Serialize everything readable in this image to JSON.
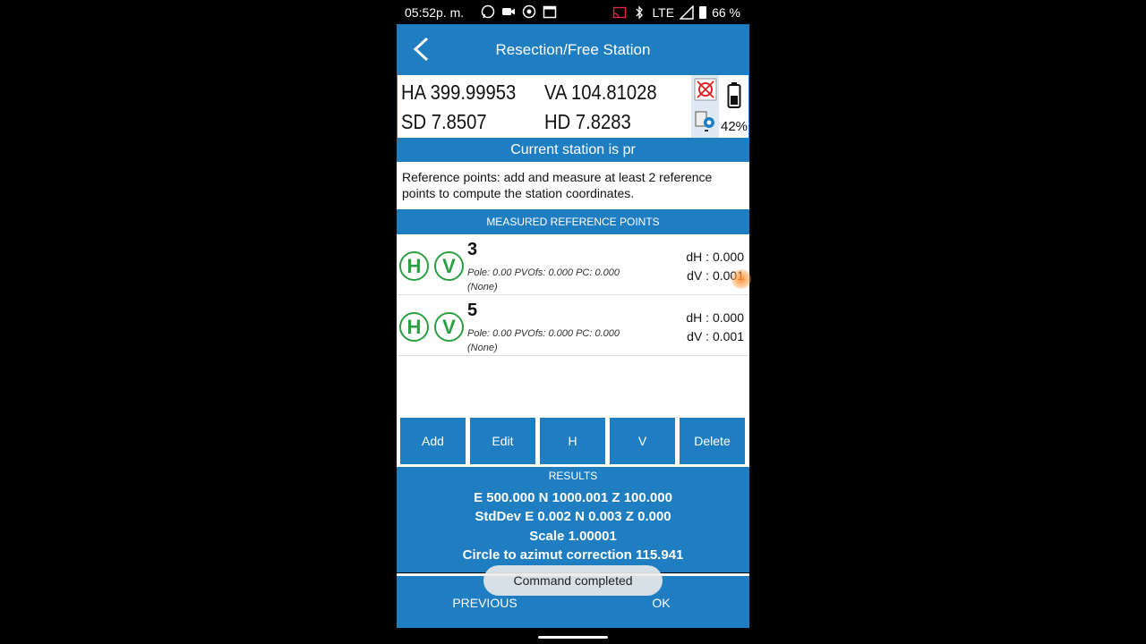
{
  "status_bar": {
    "time": "05:52p. m.",
    "network": "LTE",
    "battery": "66 %"
  },
  "app_bar": {
    "title": "Resection/Free Station"
  },
  "measurements": {
    "ha": "HA 399.99953",
    "va": "VA 104.81028",
    "sd": "SD 7.8507",
    "hd": "HD 7.8283",
    "battery_pct": "42%"
  },
  "station_banner": "Current station is pr",
  "info_text": "Reference points: add and measure at least 2 reference points to compute the station coordinates.",
  "reference_header": "MEASURED REFERENCE POINTS",
  "reference_points": [
    {
      "name": "3",
      "h_badge": "H",
      "v_badge": "V",
      "detail": "Pole: 0.00 PVOfs: 0.000 PC: 0.000",
      "code": "(None)",
      "dh": "dH : 0.000",
      "dv": "dV : 0.001"
    },
    {
      "name": "5",
      "h_badge": "H",
      "v_badge": "V",
      "detail": "Pole: 0.00 PVOfs: 0.000 PC: 0.000",
      "code": "(None)",
      "dh": "dH : 0.000",
      "dv": "dV : 0.001"
    }
  ],
  "buttons": {
    "add": "Add",
    "edit": "Edit",
    "h": "H",
    "v": "V",
    "delete": "Delete"
  },
  "results": {
    "header": "RESULTS",
    "coords": "E 500.000 N 1000.001 Z 100.000",
    "stddev": "StdDev E 0.002 N 0.003 Z 0.000",
    "scale": "Scale 1.00001",
    "circle": "Circle to azimut correction 115.941"
  },
  "footer": {
    "previous": "PREVIOUS",
    "ok": "OK"
  },
  "toast": "Command completed",
  "colors": {
    "primary": "#1f7dc2",
    "badge_green": "#2aa043",
    "touch": "#ff8c28"
  }
}
